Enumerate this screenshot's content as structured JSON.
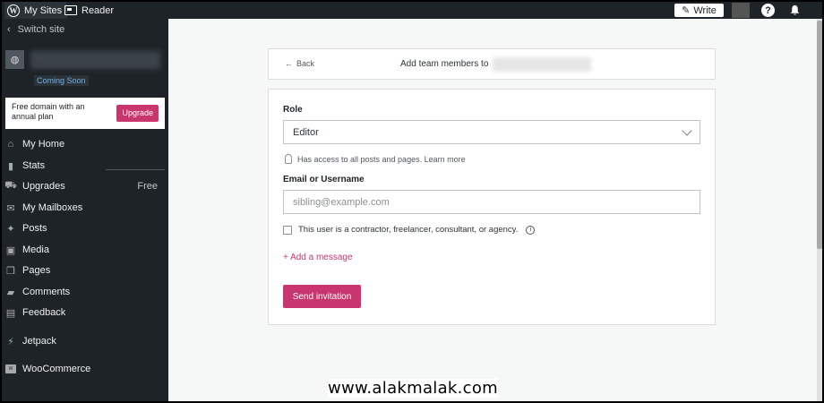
{
  "topbar": {
    "my_sites": "My Sites",
    "reader": "Reader",
    "write": "Write",
    "help": "?"
  },
  "sidebar": {
    "switch_site": "Switch site",
    "coming_soon": "Coming Soon",
    "promo_text": "Free domain with an annual plan",
    "promo_button": "Upgrade",
    "items": [
      {
        "label": "My Home",
        "icon": "home-icon"
      },
      {
        "label": "Stats",
        "icon": "stats-icon"
      },
      {
        "label": "Upgrades",
        "icon": "cart-icon",
        "badge": "Free"
      },
      {
        "label": "My Mailboxes",
        "icon": "mail-icon"
      },
      {
        "label": "Posts",
        "icon": "pin-icon"
      },
      {
        "label": "Media",
        "icon": "media-icon"
      },
      {
        "label": "Pages",
        "icon": "pages-icon"
      },
      {
        "label": "Comments",
        "icon": "comments-icon"
      },
      {
        "label": "Feedback",
        "icon": "feedback-icon"
      },
      {
        "label": "Jetpack",
        "icon": "jetpack-icon"
      },
      {
        "label": "WooCommerce",
        "icon": "woo-icon"
      }
    ]
  },
  "header": {
    "back": "Back",
    "title": "Add team members to"
  },
  "form": {
    "role_label": "Role",
    "role_value": "Editor",
    "role_hint": "Has access to all posts and pages. Learn more",
    "email_label": "Email or Username",
    "email_placeholder": "sibling@example.com",
    "contractor_label": "This user is a contractor, freelancer, consultant, or agency.",
    "add_message": "+ Add a message",
    "send_button": "Send invitation"
  },
  "watermark": "www.alakmalak.com",
  "colors": {
    "accent": "#c9356e",
    "sidebar_bg": "#1d2327"
  }
}
